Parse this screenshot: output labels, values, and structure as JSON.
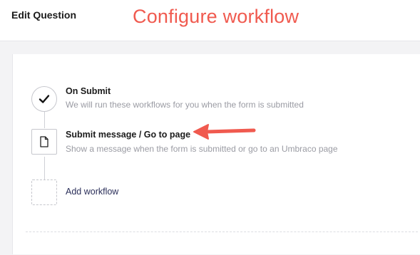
{
  "header": {
    "title": "Edit Question",
    "annotation": "Configure workflow"
  },
  "workflow": {
    "steps": [
      {
        "title": "On Submit",
        "description": "We will run these workflows for you when the form is submitted",
        "icon": "checkmark-icon"
      },
      {
        "title": "Submit message / Go to page",
        "description": "Show a message when the form is submitted or go to an Umbraco page",
        "icon": "document-icon"
      }
    ],
    "add_label": "Add workflow"
  },
  "colors": {
    "annotation": "#f05a4f",
    "link": "#2b2f5a",
    "muted_text": "#9a9ba3",
    "border": "#c6c7cd"
  }
}
